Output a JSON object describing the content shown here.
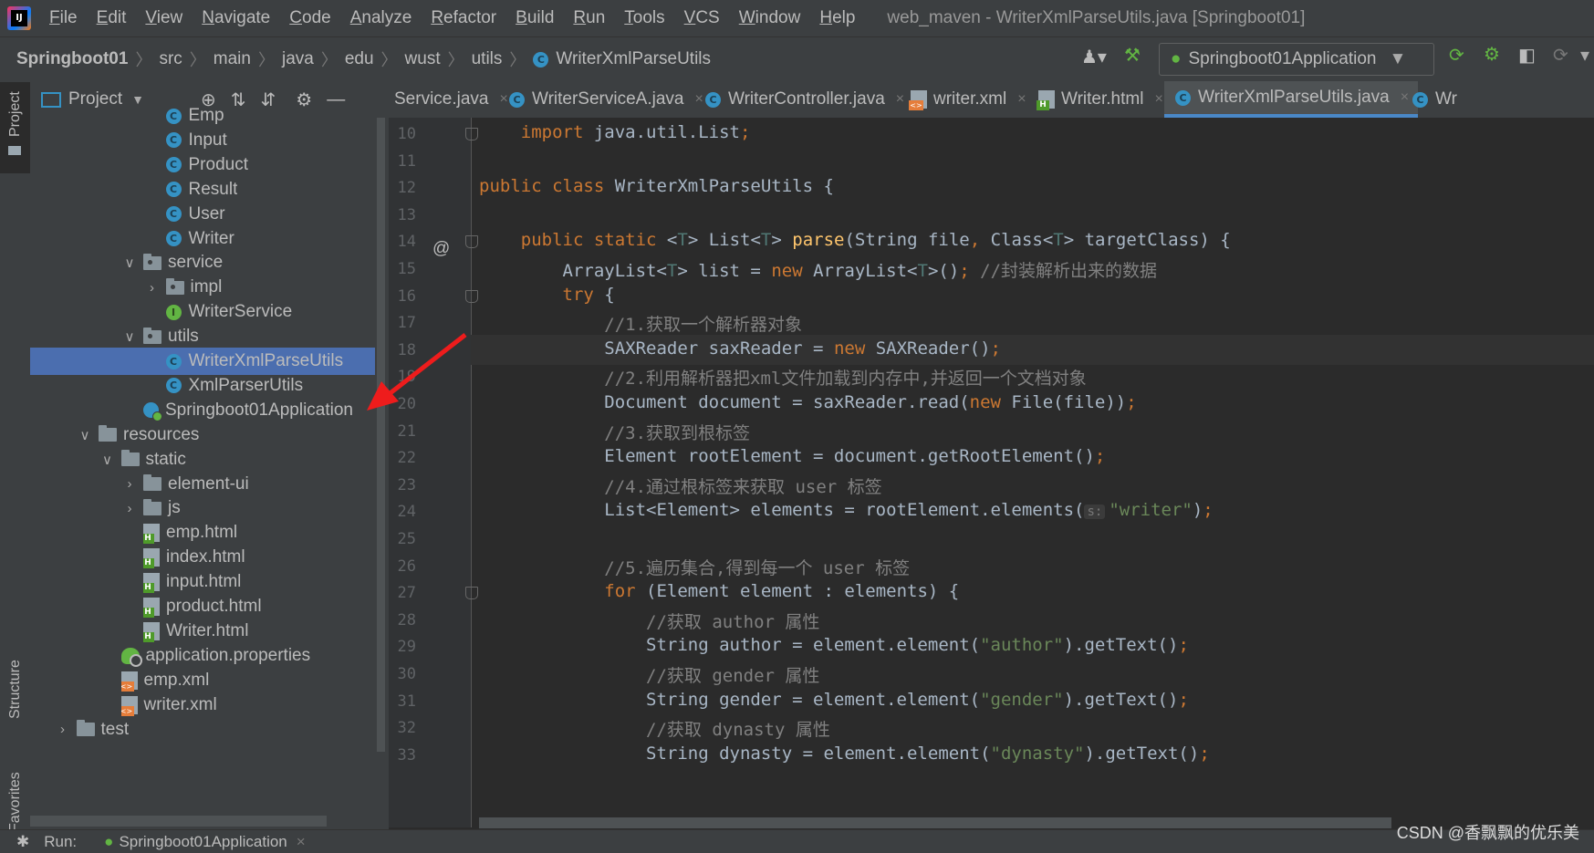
{
  "menubar": {
    "logo": "IJ",
    "items": [
      {
        "label": "File",
        "mn": "F",
        "rest": "ile"
      },
      {
        "label": "Edit",
        "mn": "E",
        "rest": "dit"
      },
      {
        "label": "View",
        "mn": "V",
        "rest": "iew"
      },
      {
        "label": "Navigate",
        "mn": "N",
        "rest": "avigate"
      },
      {
        "label": "Code",
        "mn": "C",
        "rest": "ode"
      },
      {
        "label": "Analyze",
        "mn": "A",
        "rest": "nalyze"
      },
      {
        "label": "Refactor",
        "mn": "R",
        "rest": "efactor"
      },
      {
        "label": "Build",
        "mn": "B",
        "rest": "uild"
      },
      {
        "label": "Run",
        "mn": "R",
        "rest": "un"
      },
      {
        "label": "Tools",
        "mn": "T",
        "rest": "ools"
      },
      {
        "label": "VCS",
        "mn": "V",
        "rest": "CS"
      },
      {
        "label": "Window",
        "mn": "W",
        "rest": "indow"
      },
      {
        "label": "Help",
        "mn": "H",
        "rest": "elp"
      }
    ],
    "window_title": "web_maven - WriterXmlParseUtils.java [Springboot01]"
  },
  "breadcrumb": [
    "Springboot01",
    "src",
    "main",
    "java",
    "edu",
    "wust",
    "utils",
    "WriterXmlParseUtils"
  ],
  "run_config": "Springboot01Application",
  "project_panel": {
    "title": "Project",
    "left_tabs": {
      "project": "Project",
      "structure": "Structure",
      "favorites": "Favorites"
    },
    "tree": [
      {
        "label": "Emp",
        "kind": "class",
        "indent": 4
      },
      {
        "label": "Input",
        "kind": "class",
        "indent": 4
      },
      {
        "label": "Product",
        "kind": "class",
        "indent": 4
      },
      {
        "label": "Result",
        "kind": "class",
        "indent": 4
      },
      {
        "label": "User",
        "kind": "class",
        "indent": 4
      },
      {
        "label": "Writer",
        "kind": "class",
        "indent": 4
      },
      {
        "label": "service",
        "kind": "package",
        "indent": 3,
        "chevron": "open"
      },
      {
        "label": "impl",
        "kind": "package",
        "indent": 4,
        "chevron": "closed"
      },
      {
        "label": "WriterService",
        "kind": "interface",
        "indent": 4
      },
      {
        "label": "utils",
        "kind": "package",
        "indent": 3,
        "chevron": "open"
      },
      {
        "label": "WriterXmlParseUtils",
        "kind": "class",
        "indent": 4,
        "selected": true
      },
      {
        "label": "XmlParserUtils",
        "kind": "class",
        "indent": 4
      },
      {
        "label": "Springboot01Application",
        "kind": "app",
        "indent": 3
      },
      {
        "label": "resources",
        "kind": "folder",
        "indent": 1,
        "chevron": "open"
      },
      {
        "label": "static",
        "kind": "folder",
        "indent": 2,
        "chevron": "open"
      },
      {
        "label": "element-ui",
        "kind": "folder",
        "indent": 3,
        "chevron": "closed"
      },
      {
        "label": "js",
        "kind": "folder",
        "indent": 3,
        "chevron": "closed"
      },
      {
        "label": "emp.html",
        "kind": "html",
        "indent": 3
      },
      {
        "label": "index.html",
        "kind": "html",
        "indent": 3
      },
      {
        "label": "input.html",
        "kind": "html",
        "indent": 3
      },
      {
        "label": "product.html",
        "kind": "html",
        "indent": 3
      },
      {
        "label": "Writer.html",
        "kind": "html",
        "indent": 3
      },
      {
        "label": "application.properties",
        "kind": "props",
        "indent": 2
      },
      {
        "label": "emp.xml",
        "kind": "xml",
        "indent": 2
      },
      {
        "label": "writer.xml",
        "kind": "xml",
        "indent": 2
      },
      {
        "label": "test",
        "kind": "folder",
        "indent": 0,
        "chevron": "closed"
      }
    ]
  },
  "tabs": [
    {
      "label": "Service.java",
      "icon": "none"
    },
    {
      "label": "WriterServiceA.java",
      "icon": "class"
    },
    {
      "label": "WriterController.java",
      "icon": "class"
    },
    {
      "label": "writer.xml",
      "icon": "xml"
    },
    {
      "label": "Writer.html",
      "icon": "html"
    },
    {
      "label": "WriterXmlParseUtils.java",
      "icon": "class",
      "active": true
    },
    {
      "label": "Wr",
      "icon": "class"
    }
  ],
  "editor": {
    "hint_label": "s:",
    "lines": [
      {
        "n": "10",
        "html": "    <span class='kw'>import</span> java.util.List<span class='kw'>;</span>"
      },
      {
        "n": "11",
        "html": ""
      },
      {
        "n": "12",
        "html": "<span class='kw'>public class</span> WriterXmlParseUtils {"
      },
      {
        "n": "13",
        "html": ""
      },
      {
        "n": "14",
        "html": "    <span class='kw'>public static</span> &lt;<span class='tp'>T</span>&gt; List&lt;<span class='tp'>T</span>&gt; <span class='fn'>parse</span>(String file<span class='kw'>,</span> Class&lt;<span class='tp'>T</span>&gt; targetClass) {"
      },
      {
        "n": "15",
        "html": "        ArrayList&lt;<span class='tp'>T</span>&gt; list = <span class='kw'>new</span> ArrayList&lt;<span class='tp'>T</span>&gt;()<span class='kw'>;</span> <span class='cm'>//封装解析出来的数据</span>"
      },
      {
        "n": "16",
        "html": "        <span class='kw'>try</span> {"
      },
      {
        "n": "17",
        "html": "            <span class='cm'>//1.获取一个解析器对象</span>"
      },
      {
        "n": "18",
        "html": "            SAXReader saxReader = <span class='kw'>new</span> SAXReader()<span class='kw'>;</span>"
      },
      {
        "n": "19",
        "html": "            <span class='cm'>//2.利用解析器把xml文件加载到内存中,并返回一个文档对象</span>"
      },
      {
        "n": "20",
        "html": "            Document document = saxReader.read(<span class='kw'>new</span> File(file))<span class='kw'>;</span>"
      },
      {
        "n": "21",
        "html": "            <span class='cm'>//3.获取到根标签</span>"
      },
      {
        "n": "22",
        "html": "            Element rootElement = document.getRootElement()<span class='kw'>;</span>"
      },
      {
        "n": "23",
        "html": "            <span class='cm'>//4.通过根标签来获取 user 标签</span>"
      },
      {
        "n": "24",
        "html": "            List&lt;Element&gt; elements = rootElement.elements(<span class='hint'>s:</span><span class='str'>\"writer\"</span>)<span class='kw'>;</span>"
      },
      {
        "n": "25",
        "html": ""
      },
      {
        "n": "26",
        "html": "            <span class='cm'>//5.遍历集合,得到每一个 user 标签</span>"
      },
      {
        "n": "27",
        "html": "            <span class='kw'>for</span> (Element element : elements) {"
      },
      {
        "n": "28",
        "html": "                <span class='cm'>//获取 author 属性</span>"
      },
      {
        "n": "29",
        "html": "                String author = element.element(<span class='str'>\"author\"</span>).getText()<span class='kw'>;</span>"
      },
      {
        "n": "30",
        "html": "                <span class='cm'>//获取 gender 属性</span>"
      },
      {
        "n": "31",
        "html": "                String gender = element.element(<span class='str'>\"gender\"</span>).getText()<span class='kw'>;</span>"
      },
      {
        "n": "32",
        "html": "                <span class='cm'>//获取 dynasty 属性</span>"
      },
      {
        "n": "33",
        "html": "                String dynasty = element.element(<span class='str'>\"dynasty\"</span>).getText()<span class='kw'>;</span>"
      }
    ],
    "current_line": "18",
    "override_marker": "@"
  },
  "bottom": {
    "run_label": "Run:",
    "run_config": "Springboot01Application"
  },
  "watermark": "CSDN @香飘飘的优乐美"
}
